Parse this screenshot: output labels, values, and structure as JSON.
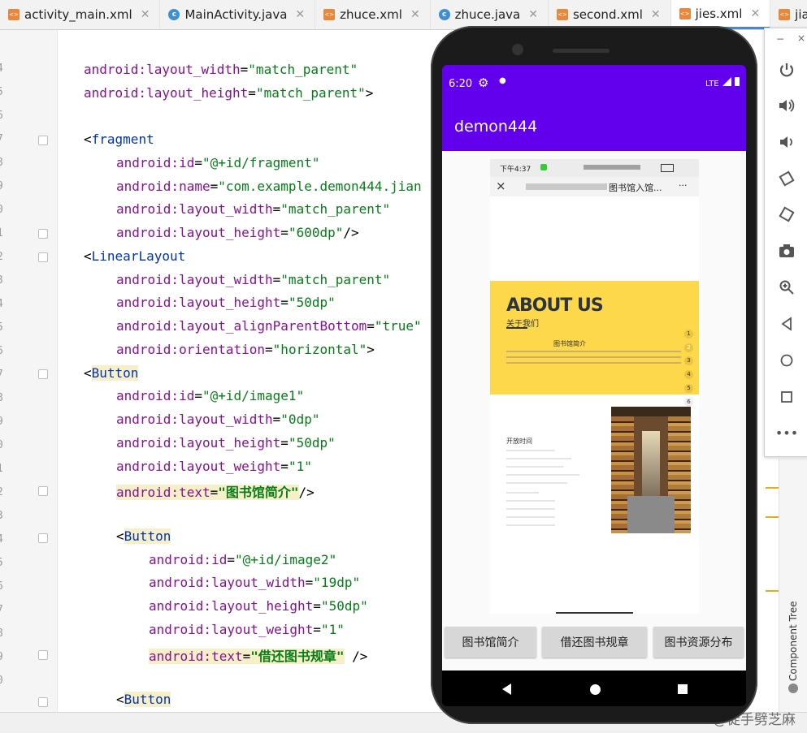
{
  "tabs": [
    {
      "label": "activity_main.xml",
      "type": "xml",
      "active": false
    },
    {
      "label": "MainActivity.java",
      "type": "java",
      "active": false
    },
    {
      "label": "zhuce.xml",
      "type": "xml",
      "active": false
    },
    {
      "label": "zhuce.java",
      "type": "java",
      "active": false
    },
    {
      "label": "second.xml",
      "type": "xml",
      "active": false
    },
    {
      "label": "jies.xml",
      "type": "xml",
      "active": true
    },
    {
      "label": "jianjie.xml",
      "type": "xml",
      "active": false
    }
  ],
  "line_numbers": [
    "4",
    "5",
    "6",
    "7",
    "8",
    "9",
    "0",
    "1",
    "2",
    "3",
    "4",
    "5",
    "6",
    "7",
    "8",
    "9",
    "0",
    "1",
    "2",
    "3",
    "4",
    "5",
    "6",
    "7",
    "8",
    "9",
    "0"
  ],
  "code": {
    "l1": {
      "attr": "android:layout_width",
      "val": "\"match_parent\""
    },
    "l2": {
      "attr": "android:layout_height",
      "val": "\"match_parent\"",
      "close": ">"
    },
    "l3": {
      "open": "<",
      "tag": "fragment"
    },
    "l4": {
      "attr": "android:id",
      "val": "\"@+id/fragment\""
    },
    "l5": {
      "attr": "android:name",
      "val": "\"com.example.demon444.jian"
    },
    "l6": {
      "attr": "android:layout_width",
      "val": "\"match_parent\""
    },
    "l7": {
      "attr": "android:layout_height",
      "val": "\"600dp\"",
      "close": "/>"
    },
    "l8": {
      "open": "<",
      "tag": "LinearLayout"
    },
    "l9": {
      "attr": "android:layout_width",
      "val": "\"match_parent\""
    },
    "l10": {
      "attr": "android:layout_height",
      "val": "\"50dp\""
    },
    "l11": {
      "attr": "android:layout_alignParentBottom",
      "val": "\"true\""
    },
    "l12": {
      "attr": "android:orientation",
      "val": "\"horizontal\"",
      "close": ">"
    },
    "l13": {
      "open": "<",
      "tag": "Button"
    },
    "l14": {
      "attr": "android:id",
      "val": "\"@+id/image1\""
    },
    "l15": {
      "attr": "android:layout_width",
      "val": "\"0dp\""
    },
    "l16": {
      "attr": "android:layout_height",
      "val": "\"50dp\""
    },
    "l17": {
      "attr": "android:layout_weight",
      "val": "\"1\""
    },
    "l18": {
      "attr": "android:text",
      "val": "\"图书馆简介\"",
      "close": "/>"
    },
    "l19": {
      "open": "<",
      "tag": "Button"
    },
    "l20": {
      "attr": "android:id",
      "val": "\"@+id/image2\""
    },
    "l21": {
      "attr": "android:layout_width",
      "val": "\"19dp\""
    },
    "l22": {
      "attr": "android:layout_height",
      "val": "\"50dp\""
    },
    "l23": {
      "attr": "android:layout_weight",
      "val": "\"1\""
    },
    "l24": {
      "attr": "android:text",
      "val": "\"借还图书规章\"",
      "close": "/>"
    },
    "l25": {
      "open": "<",
      "tag": "Button"
    }
  },
  "component_tree_label": "Component Tree",
  "watermark": "CSDN @徒手劈芝麻",
  "emulator": {
    "status_time": "6:20",
    "status_right": "LTE",
    "app_title": "demon444",
    "inner_status_time": "下午4:37",
    "inner_title": "图书馆入馆...",
    "inner_more": "···",
    "about_title": "ABOUT US",
    "about_sub": "关于我们",
    "about_section": "图书馆简介",
    "open_title": "开放时间",
    "page_dots": [
      "1",
      "2",
      "3",
      "4",
      "5",
      "6"
    ],
    "buttons": [
      "图书馆简介",
      "借还图书规章",
      "图书资源分布"
    ]
  },
  "emulator_toolbar": {
    "icons": [
      "power-icon",
      "volume-up-icon",
      "volume-down-icon",
      "rotate-left-icon",
      "rotate-right-icon",
      "camera-icon",
      "zoom-icon",
      "back-icon",
      "home-icon",
      "overview-icon",
      "more-icon"
    ]
  },
  "colors": {
    "app_primary": "#6200ee",
    "about_bg": "#fdd84a"
  }
}
